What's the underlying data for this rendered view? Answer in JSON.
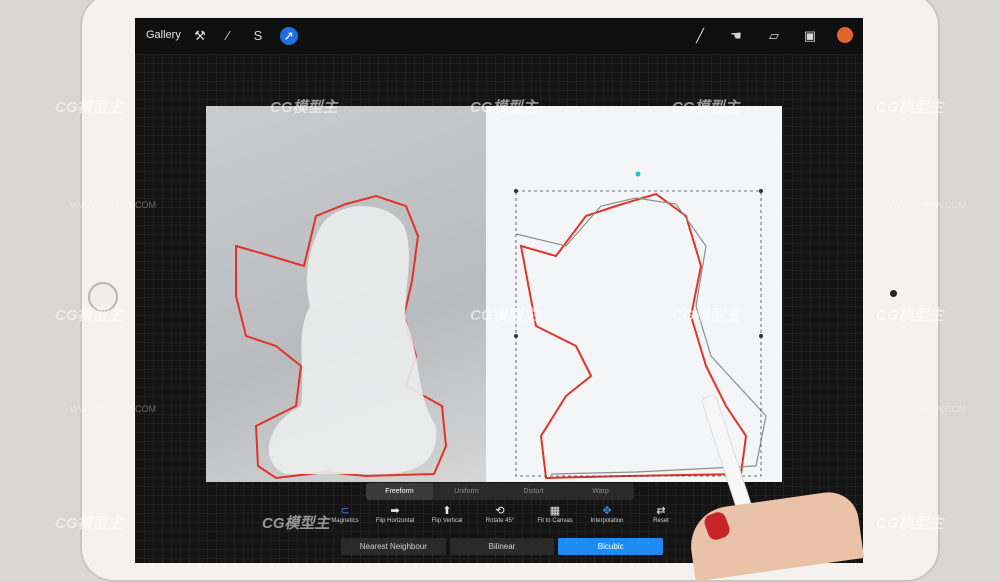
{
  "topbar": {
    "gallery_label": "Gallery",
    "left_tools": [
      {
        "icon": "wrench-icon",
        "glyph": "⚒"
      },
      {
        "icon": "adjustments-icon",
        "glyph": "⁄"
      },
      {
        "icon": "selection-icon",
        "glyph": "S"
      },
      {
        "icon": "transform-arrow-icon",
        "glyph": "➚"
      }
    ],
    "right_tools": [
      {
        "icon": "brush-icon",
        "glyph": "╱"
      },
      {
        "icon": "smudge-icon",
        "glyph": "☚"
      },
      {
        "icon": "eraser-icon",
        "glyph": "▱"
      },
      {
        "icon": "layers-icon",
        "glyph": "▣"
      }
    ],
    "color_swatch": "#e4632a"
  },
  "transform_modes": {
    "items": [
      "Freeform",
      "Uniform",
      "Distort",
      "Warp"
    ],
    "active": "Freeform"
  },
  "toolbar": {
    "items": [
      {
        "label": "Magnetics",
        "icon": "magnet-icon",
        "glyph": "⊂",
        "active": true
      },
      {
        "label": "Flip Horizontal",
        "icon": "flip-horizontal-icon",
        "glyph": "➡"
      },
      {
        "label": "Flip Vertical",
        "icon": "flip-vertical-icon",
        "glyph": "⬆"
      },
      {
        "label": "Rotate 45°",
        "icon": "rotate-icon",
        "glyph": "⟲"
      },
      {
        "label": "Fit to Canvas",
        "icon": "fit-canvas-icon",
        "glyph": "▦"
      },
      {
        "label": "Interpolation",
        "icon": "interpolation-icon",
        "glyph": "✥"
      },
      {
        "label": "Reset",
        "icon": "reset-icon",
        "glyph": "⇄"
      }
    ]
  },
  "interpolation": {
    "items": [
      "Nearest Neighbour",
      "Bilinear",
      "Bicubic"
    ],
    "active": "Bicubic"
  },
  "colors": {
    "accent": "#1f8cf5",
    "stroke": "#e0342a"
  },
  "watermark": {
    "text": "CG模型主",
    "url": "WWW.CGMXW.COM"
  }
}
